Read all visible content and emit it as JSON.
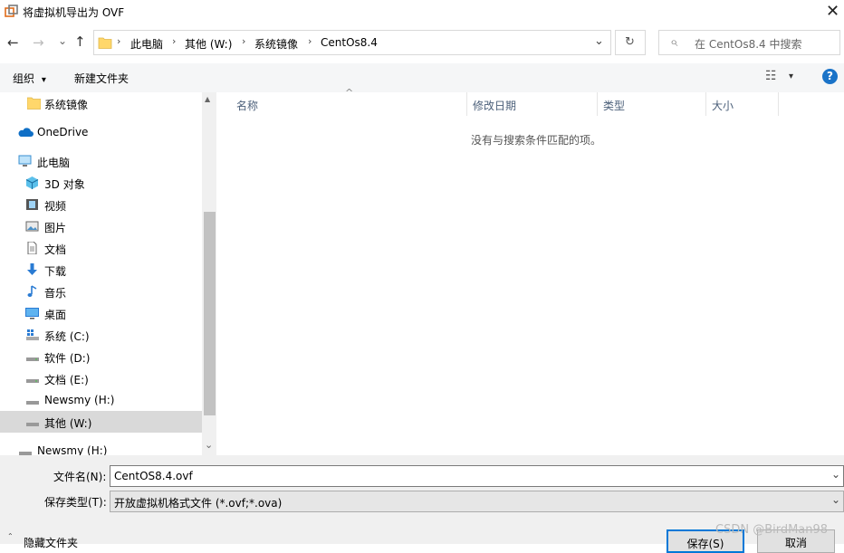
{
  "window": {
    "title": "将虚拟机导出为 OVF",
    "close_glyph": "✕"
  },
  "nav": {
    "back_glyph": "←",
    "forward_glyph": "→",
    "recent_glyph": "⌄",
    "up_glyph": "↑",
    "breadcrumb": [
      "此电脑",
      "其他 (W:)",
      "系统镜像",
      "CentOs8.4"
    ],
    "separator": "›",
    "dropdown_glyph": "⌄",
    "refresh_glyph": "↻",
    "search_placeholder": "在 CentOs8.4 中搜索",
    "search_glyph": "⌕"
  },
  "toolbar": {
    "organize": "组织",
    "organize_glyph": "▾",
    "new_folder": "新建文件夹",
    "view_glyph": "☷",
    "view_dropdown": "▾",
    "help_glyph": "?"
  },
  "sidebar": {
    "items": [
      {
        "label": "系统镜像",
        "icon": "folder-icon"
      },
      {
        "label": "OneDrive",
        "icon": "cloud-icon"
      },
      {
        "label": "此电脑",
        "icon": "computer-icon"
      },
      {
        "label": "3D 对象",
        "icon": "cube-icon"
      },
      {
        "label": "视频",
        "icon": "video-icon"
      },
      {
        "label": "图片",
        "icon": "picture-icon"
      },
      {
        "label": "文档",
        "icon": "document-icon"
      },
      {
        "label": "下载",
        "icon": "download-icon"
      },
      {
        "label": "音乐",
        "icon": "music-icon"
      },
      {
        "label": "桌面",
        "icon": "desktop-icon"
      },
      {
        "label": "系统 (C:)",
        "icon": "windows-drive-icon"
      },
      {
        "label": "软件 (D:)",
        "icon": "drive-icon"
      },
      {
        "label": "文档 (E:)",
        "icon": "drive-icon"
      },
      {
        "label": "Newsmy (H:)",
        "icon": "drive-icon"
      },
      {
        "label": "其他 (W:)",
        "icon": "drive-icon",
        "selected": true
      },
      {
        "label": "Newsmy (H:)",
        "icon": "drive-icon"
      }
    ],
    "scroll_up": "▲",
    "scroll_down": "⌄"
  },
  "columns": {
    "name": "名称",
    "modified": "修改日期",
    "type": "类型",
    "size": "大小",
    "sort_glyph": "^"
  },
  "empty_message": "没有与搜索条件匹配的项。",
  "footer": {
    "filename_label": "文件名(N):",
    "filename_value": "CentOS8.4.ovf",
    "filetype_label": "保存类型(T):",
    "filetype_value": "开放虚拟机格式文件 (*.ovf;*.ova)",
    "dropdown_glyph": "⌄",
    "hide_folders": "隐藏文件夹",
    "save_button": "保存(S)",
    "cancel_button": "取消",
    "watermark": "CSDN @BirdMan98"
  }
}
